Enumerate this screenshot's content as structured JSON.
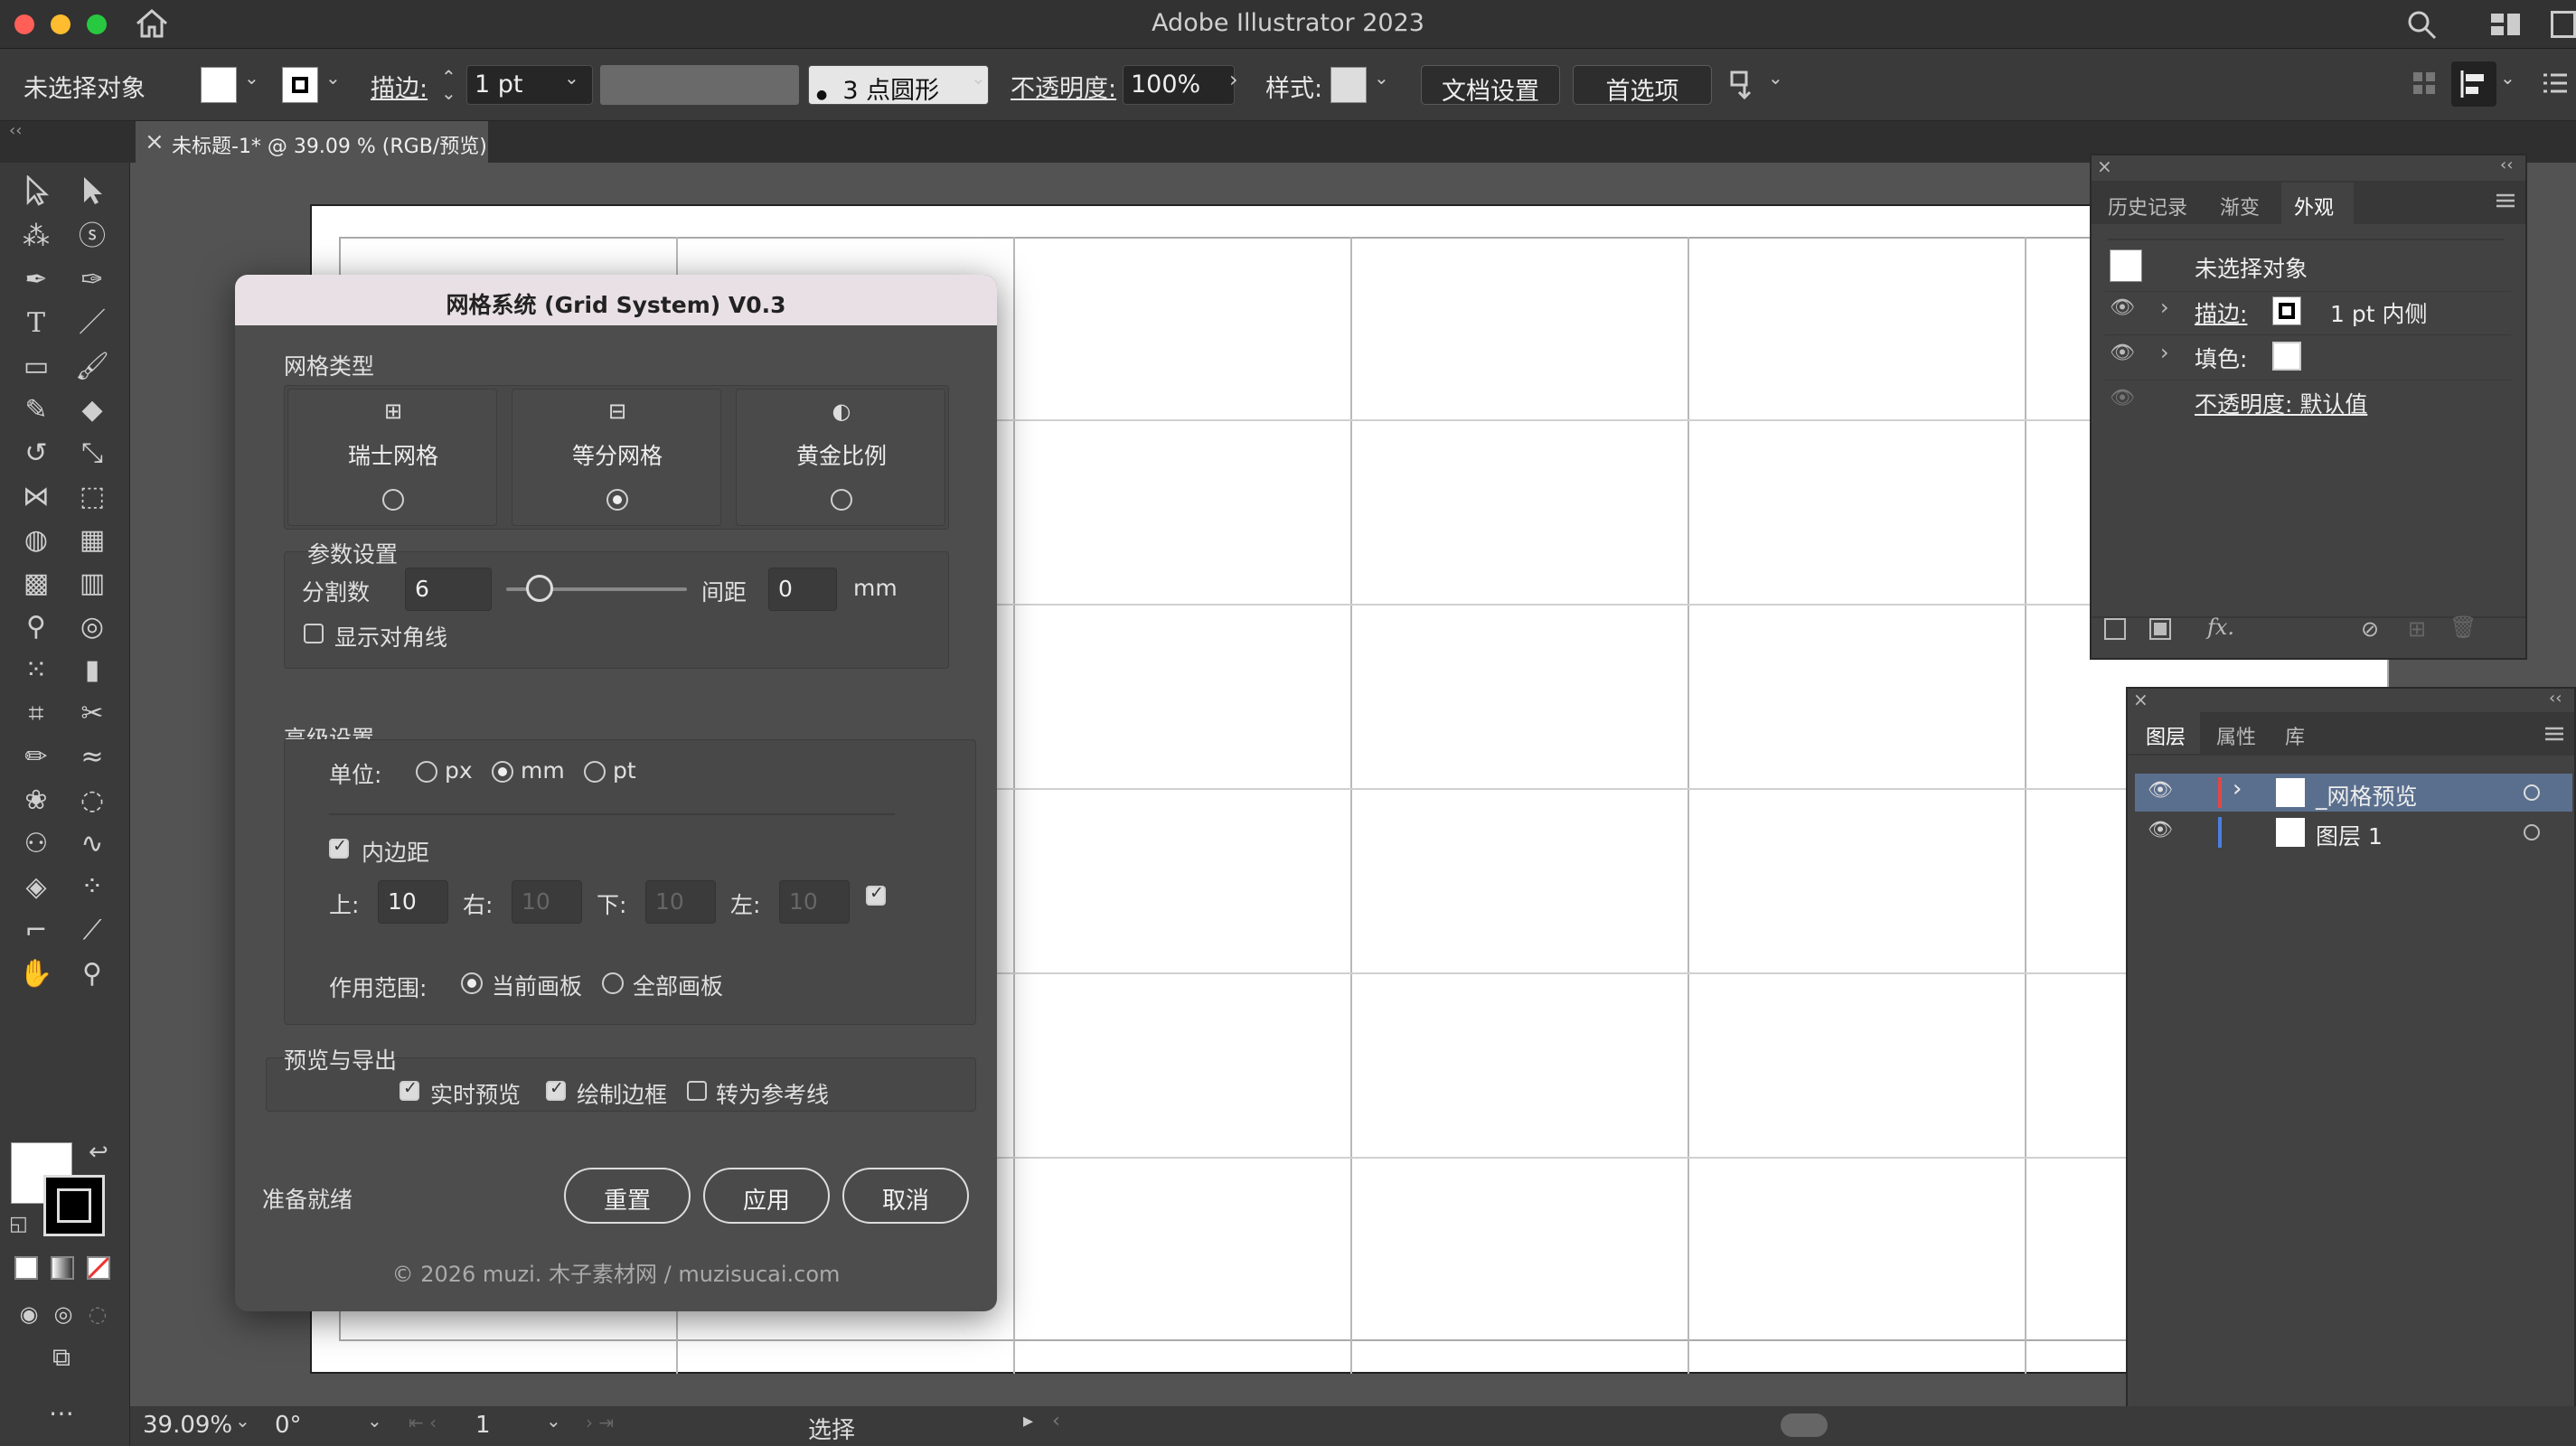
{
  "window": {
    "title": "Adobe Illustrator 2023"
  },
  "control_bar": {
    "no_selection": "未选择对象",
    "stroke_label": "描边:",
    "stroke_value": "1 pt",
    "brush_label": "3 点圆形",
    "opacity_label": "不透明度:",
    "opacity_value": "100%",
    "style_label": "样式:",
    "doc_setup": "文档设置",
    "preferences": "首选项"
  },
  "document_tab": {
    "close": "×",
    "title": "未标题-1* @ 39.09 % (RGB/预览)"
  },
  "appearance_panel": {
    "tabs": [
      "历史记录",
      "渐变",
      "外观"
    ],
    "header": "未选择对象",
    "rows": [
      {
        "label": "描边:",
        "value": "1 pt  内侧"
      },
      {
        "label": "填色:",
        "value": ""
      },
      {
        "label": "不透明度: 默认值",
        "value": ""
      }
    ],
    "fx": "fx."
  },
  "layers_panel": {
    "tabs": [
      "图层",
      "属性",
      "库"
    ],
    "layers": [
      {
        "name": "_网格预览",
        "color": "#e04848"
      },
      {
        "name": "图层 1",
        "color": "#4a7fe0"
      }
    ]
  },
  "dialog": {
    "title": "网格系统 (Grid System) V0.3",
    "grid_type_label": "网格类型",
    "grid_types": [
      {
        "icon": "⊞",
        "label": "瑞士网格",
        "selected": false
      },
      {
        "icon": "⊟",
        "label": "等分网格",
        "selected": true
      },
      {
        "icon": "◐",
        "label": "黄金比例",
        "selected": false
      }
    ],
    "params_label": "参数设置",
    "divisions_label": "分割数",
    "divisions_value": "6",
    "gap_label": "间距",
    "gap_value": "0",
    "gap_unit": "mm",
    "show_diagonal": "显示对角线",
    "advanced_label": "高级设置",
    "unit_label": "单位:",
    "units": [
      "px",
      "mm",
      "pt"
    ],
    "padding_label": "内边距",
    "top_label": "上:",
    "top_value": "10",
    "right_label": "右:",
    "right_value": "10",
    "bottom_label": "下:",
    "bottom_value": "10",
    "left_label": "左:",
    "left_value": "10",
    "scope_label": "作用范围:",
    "scope_current": "当前画板",
    "scope_all": "全部画板",
    "preview_label": "预览与导出",
    "live_preview": "实时预览",
    "draw_border": "绘制边框",
    "to_guides": "转为参考线",
    "status": "准备就绪",
    "reset": "重置",
    "apply": "应用",
    "cancel": "取消",
    "footer": "© 2026 muzi. 木子素材网 / muzisucai.com"
  },
  "status_bar": {
    "zoom": "39.09%",
    "rotation": "0°",
    "artboard": "1",
    "tool": "选择"
  }
}
